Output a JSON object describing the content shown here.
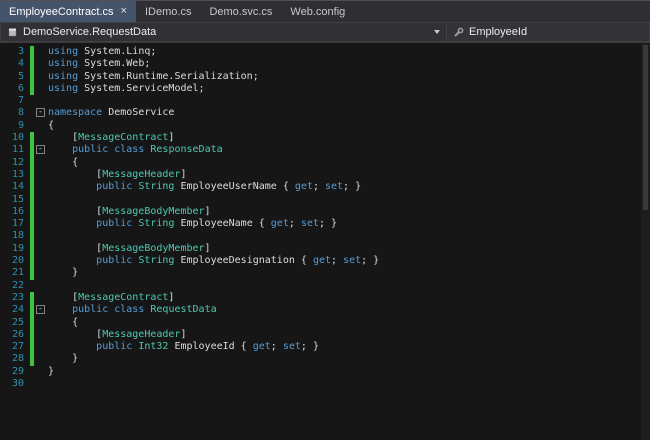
{
  "tab_close_glyph": "×",
  "tabs": [
    {
      "label": "EmployeeContract.cs",
      "active": true
    },
    {
      "label": "IDemo.cs",
      "active": false
    },
    {
      "label": "Demo.svc.cs",
      "active": false
    },
    {
      "label": "Web.config",
      "active": false
    }
  ],
  "navbar": {
    "type_dropdown": "DemoService.RequestData",
    "member_dropdown": "EmployeeId"
  },
  "colors": {
    "keyword": "#569cd6",
    "user_type": "#4ec9b0",
    "attribute": "#4ec9b0",
    "plain_text": "#dcdcdc",
    "line_number": "#2b91af",
    "change_bar_green": "#3fc43f",
    "active_tab_bg": "#44546a",
    "editor_bg": "#161616"
  },
  "editor": {
    "first_line": 3,
    "last_line": 30,
    "lines": [
      {
        "n": 3,
        "g": 1,
        "seg": [
          [
            "kw",
            "using"
          ],
          [
            "pl",
            " System.Linq;"
          ]
        ]
      },
      {
        "n": 4,
        "g": 1,
        "seg": [
          [
            "kw",
            "using"
          ],
          [
            "pl",
            " System.Web;"
          ]
        ]
      },
      {
        "n": 5,
        "g": 1,
        "seg": [
          [
            "kw",
            "using"
          ],
          [
            "pl",
            " System.Runtime.Serialization;"
          ]
        ]
      },
      {
        "n": 6,
        "g": 1,
        "seg": [
          [
            "kw",
            "using"
          ],
          [
            "pl",
            " System.ServiceModel;"
          ]
        ]
      },
      {
        "n": 7,
        "g": 0,
        "seg": []
      },
      {
        "n": 8,
        "g": 0,
        "fold": "-",
        "seg": [
          [
            "kw",
            "namespace"
          ],
          [
            "pl",
            " DemoService"
          ]
        ]
      },
      {
        "n": 9,
        "g": 0,
        "seg": [
          [
            "pl",
            "{"
          ]
        ]
      },
      {
        "n": 10,
        "g": 1,
        "seg": [
          [
            "pl",
            "    ["
          ],
          [
            "at",
            "MessageContract"
          ],
          [
            "pl",
            "]"
          ]
        ]
      },
      {
        "n": 11,
        "g": 1,
        "fold": "-",
        "seg": [
          [
            "pl",
            "    "
          ],
          [
            "kw",
            "public"
          ],
          [
            "pl",
            " "
          ],
          [
            "kw",
            "class"
          ],
          [
            "pl",
            " "
          ],
          [
            "ty",
            "ResponseData"
          ]
        ]
      },
      {
        "n": 12,
        "g": 1,
        "seg": [
          [
            "pl",
            "    {"
          ]
        ]
      },
      {
        "n": 13,
        "g": 1,
        "seg": [
          [
            "pl",
            "        ["
          ],
          [
            "at",
            "MessageHeader"
          ],
          [
            "pl",
            "]"
          ]
        ]
      },
      {
        "n": 14,
        "g": 1,
        "seg": [
          [
            "pl",
            "        "
          ],
          [
            "kw",
            "public"
          ],
          [
            "pl",
            " "
          ],
          [
            "ty",
            "String"
          ],
          [
            "pl",
            " EmployeeUserName { "
          ],
          [
            "kw",
            "get"
          ],
          [
            "pl",
            "; "
          ],
          [
            "kw",
            "set"
          ],
          [
            "pl",
            "; }"
          ]
        ]
      },
      {
        "n": 15,
        "g": 1,
        "seg": []
      },
      {
        "n": 16,
        "g": 1,
        "seg": [
          [
            "pl",
            "        ["
          ],
          [
            "at",
            "MessageBodyMember"
          ],
          [
            "pl",
            "]"
          ]
        ]
      },
      {
        "n": 17,
        "g": 1,
        "seg": [
          [
            "pl",
            "        "
          ],
          [
            "kw",
            "public"
          ],
          [
            "pl",
            " "
          ],
          [
            "ty",
            "String"
          ],
          [
            "pl",
            " EmployeeName { "
          ],
          [
            "kw",
            "get"
          ],
          [
            "pl",
            "; "
          ],
          [
            "kw",
            "set"
          ],
          [
            "pl",
            "; }"
          ]
        ]
      },
      {
        "n": 18,
        "g": 1,
        "seg": []
      },
      {
        "n": 19,
        "g": 1,
        "seg": [
          [
            "pl",
            "        ["
          ],
          [
            "at",
            "MessageBodyMember"
          ],
          [
            "pl",
            "]"
          ]
        ]
      },
      {
        "n": 20,
        "g": 1,
        "seg": [
          [
            "pl",
            "        "
          ],
          [
            "kw",
            "public"
          ],
          [
            "pl",
            " "
          ],
          [
            "ty",
            "String"
          ],
          [
            "pl",
            " EmployeeDesignation { "
          ],
          [
            "kw",
            "get"
          ],
          [
            "pl",
            "; "
          ],
          [
            "kw",
            "set"
          ],
          [
            "pl",
            "; }"
          ]
        ]
      },
      {
        "n": 21,
        "g": 1,
        "seg": [
          [
            "pl",
            "    }"
          ]
        ]
      },
      {
        "n": 22,
        "g": 0,
        "seg": []
      },
      {
        "n": 23,
        "g": 1,
        "seg": [
          [
            "pl",
            "    ["
          ],
          [
            "at",
            "MessageContract"
          ],
          [
            "pl",
            "]"
          ]
        ]
      },
      {
        "n": 24,
        "g": 1,
        "fold": "-",
        "seg": [
          [
            "pl",
            "    "
          ],
          [
            "kw",
            "public"
          ],
          [
            "pl",
            " "
          ],
          [
            "kw",
            "class"
          ],
          [
            "pl",
            " "
          ],
          [
            "ty",
            "RequestData"
          ]
        ]
      },
      {
        "n": 25,
        "g": 1,
        "seg": [
          [
            "pl",
            "    {"
          ]
        ]
      },
      {
        "n": 26,
        "g": 1,
        "seg": [
          [
            "pl",
            "        ["
          ],
          [
            "at",
            "MessageHeader"
          ],
          [
            "pl",
            "]"
          ]
        ]
      },
      {
        "n": 27,
        "g": 1,
        "seg": [
          [
            "pl",
            "        "
          ],
          [
            "kw",
            "public"
          ],
          [
            "pl",
            " "
          ],
          [
            "ty",
            "Int32"
          ],
          [
            "pl",
            " EmployeeId { "
          ],
          [
            "kw",
            "get"
          ],
          [
            "pl",
            "; "
          ],
          [
            "kw",
            "set"
          ],
          [
            "pl",
            "; }"
          ]
        ]
      },
      {
        "n": 28,
        "g": 1,
        "seg": [
          [
            "pl",
            "    }"
          ]
        ]
      },
      {
        "n": 29,
        "g": 0,
        "seg": [
          [
            "pl",
            "}"
          ]
        ]
      },
      {
        "n": 30,
        "g": 0,
        "seg": []
      }
    ]
  }
}
